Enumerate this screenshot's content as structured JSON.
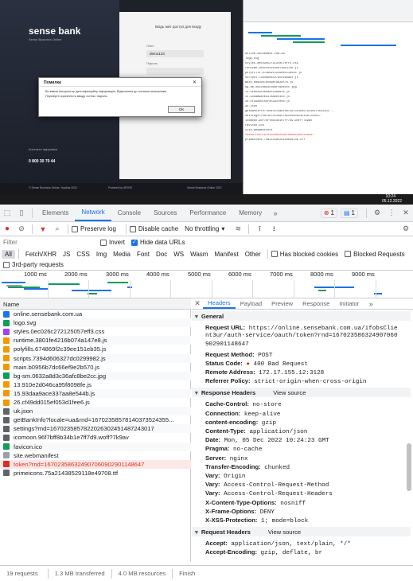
{
  "bank_app": {
    "logo": "sense bank",
    "subtitle": "Sense Business Online",
    "login_title": "Вхідь зміт доступ для входу",
    "login_label": "Логін",
    "login_value": "demo123",
    "password_label": "Пароль",
    "contact_title": "Контакти підтримки",
    "phone": "0 800 30 70 44",
    "footer_left": "© Sense Business Online, Україна 2022",
    "footer_mid": "Powered by IDRIVE",
    "footer_right": "Sense Business Online 2022",
    "dialog_title": "Помилка",
    "dialog_text_1": "Ви ввели некоректну ідентифікаційну інформацію. Відхилення до системи неможливе.",
    "dialog_text_2": "Перевірте коректність вводу логіна і пароля.",
    "dialog_ok": "OK"
  },
  "taskbar": {
    "time": "10:24",
    "date": "05.12.2022"
  },
  "devtools": {
    "tabs": [
      "Elements",
      "Network",
      "Console",
      "Sources",
      "Performance",
      "Memory"
    ],
    "active_tab": "Network",
    "error_count": "1",
    "message_count": "1",
    "preserve_log": "Preserve log",
    "disable_cache": "Disable cache",
    "throttling": "No throttling",
    "filter_placeholder": "Filter",
    "invert": "Invert",
    "hide_data_urls": "Hide data URLs",
    "filter_types": [
      "All",
      "Fetch/XHR",
      "JS",
      "CSS",
      "Img",
      "Media",
      "Font",
      "Doc",
      "WS",
      "Wasm",
      "Manifest",
      "Other"
    ],
    "has_blocked_cookies": "Has blocked cookies",
    "blocked_requests": "Blocked Requests",
    "third_party": "3rd-party requests",
    "timeline_ticks": [
      "1000 ms",
      "2000 ms",
      "3000 ms",
      "4000 ms",
      "5000 ms",
      "6000 ms",
      "7000 ms",
      "8000 ms",
      "9000 ms"
    ],
    "name_header": "Name",
    "files": [
      {
        "name": "online.sensebank.com.ua",
        "type": "doc",
        "error": false
      },
      {
        "name": "logo.svg",
        "type": "img",
        "error": false
      },
      {
        "name": "styles.0ec026c272125057eff3.css",
        "type": "css",
        "error": false
      },
      {
        "name": "runtime.3801fe4216b074a147e8.js",
        "type": "js",
        "error": false
      },
      {
        "name": "polyfills.674869f2c39ee151eb35.js",
        "type": "js",
        "error": false
      },
      {
        "name": "scripts.7394d606327dc0299982.js",
        "type": "js",
        "error": false
      },
      {
        "name": "main.b0956b7dc66ef9e2b570.js",
        "type": "js",
        "error": false
      },
      {
        "name": "bg-sm.0632a8d3c36afc8be2cc.jpg",
        "type": "img",
        "error": false
      },
      {
        "name": "13.910e2d046ca95f8098fe.js",
        "type": "js",
        "error": false
      },
      {
        "name": "15.93daa9ace337aa8e544b.js",
        "type": "js",
        "error": false
      },
      {
        "name": "26.cf49dd015ef053d1fee6.js",
        "type": "js",
        "error": false
      },
      {
        "name": "uk.json",
        "type": "xhr",
        "error": false
      },
      {
        "name": "getBankInfo?locale=ua&rnd=16702358578140373524355...",
        "type": "xhr",
        "error": false
      },
      {
        "name": "settings?rnd=16702358578220263024514872430​17",
        "type": "xhr",
        "error": false
      },
      {
        "name": "icomoon.96f7bff8b34b1e7ff7d9.woff?7k9av",
        "type": "font",
        "error": false
      },
      {
        "name": "favicon.ico",
        "type": "img",
        "error": false
      },
      {
        "name": "site.webmanifest",
        "type": "other",
        "error": false
      },
      {
        "name": "token?rnd=16702358632490706090290114864​7",
        "type": "xhr",
        "error": true
      },
      {
        "name": "primeicons.75a21438529118e49708.ttf",
        "type": "font",
        "error": false
      }
    ],
    "detail_tabs": [
      "Headers",
      "Payload",
      "Preview",
      "Response",
      "Initiator"
    ],
    "active_detail_tab": "Headers",
    "general_title": "General",
    "general": [
      {
        "k": "Request URL:",
        "v": "https://online.sensebank.com.ua/ifobsClie"
      },
      {
        "k": "",
        "v": "nt3ur/auth-service/oauth/token?rnd=167023586324907060"
      },
      {
        "k": "",
        "v": "902901148647"
      },
      {
        "k": "Request Method:",
        "v": "POST"
      },
      {
        "k": "Status Code:",
        "v": "400 Bad Request"
      },
      {
        "k": "Remote Address:",
        "v": "172.17.155.12:3128"
      },
      {
        "k": "Referrer Policy:",
        "v": "strict-origin-when-cross-origin"
      }
    ],
    "response_headers_title": "Response Headers",
    "view_source": "View source",
    "response_headers": [
      {
        "k": "Cache-Control:",
        "v": "no-store"
      },
      {
        "k": "Connection:",
        "v": "keep-alive"
      },
      {
        "k": "content-encoding:",
        "v": "gzip"
      },
      {
        "k": "Content-Type:",
        "v": "application/json"
      },
      {
        "k": "Date:",
        "v": "Mon, 05 Dec 2022 10:24:23 GMT"
      },
      {
        "k": "Pragma:",
        "v": "no-cache"
      },
      {
        "k": "Server:",
        "v": "nginx"
      },
      {
        "k": "Transfer-Encoding:",
        "v": "chunked"
      },
      {
        "k": "Vary:",
        "v": "Origin"
      },
      {
        "k": "Vary:",
        "v": "Access-Control-Request-Method"
      },
      {
        "k": "Vary:",
        "v": "Access-Control-Request-Headers"
      },
      {
        "k": "X-Content-Type-Options:",
        "v": "nosniff"
      },
      {
        "k": "X-Frame-Options:",
        "v": "DENY"
      },
      {
        "k": "X-XSS-Protection:",
        "v": "1; mode=block"
      }
    ],
    "request_headers_title": "Request Headers",
    "request_headers": [
      {
        "k": "Accept:",
        "v": "application/json, text/plain, */*"
      },
      {
        "k": "Accept-Encoding:",
        "v": "gzip, deflate, br"
      }
    ],
    "status": {
      "requests": "19 requests",
      "transferred": "1.3 MB transferred",
      "resources": "4.0 MB resources",
      "finish": "Finish"
    },
    "colors": {
      "accent": "#1a73e8",
      "error": "#d93025",
      "success": "#0d652d"
    }
  }
}
